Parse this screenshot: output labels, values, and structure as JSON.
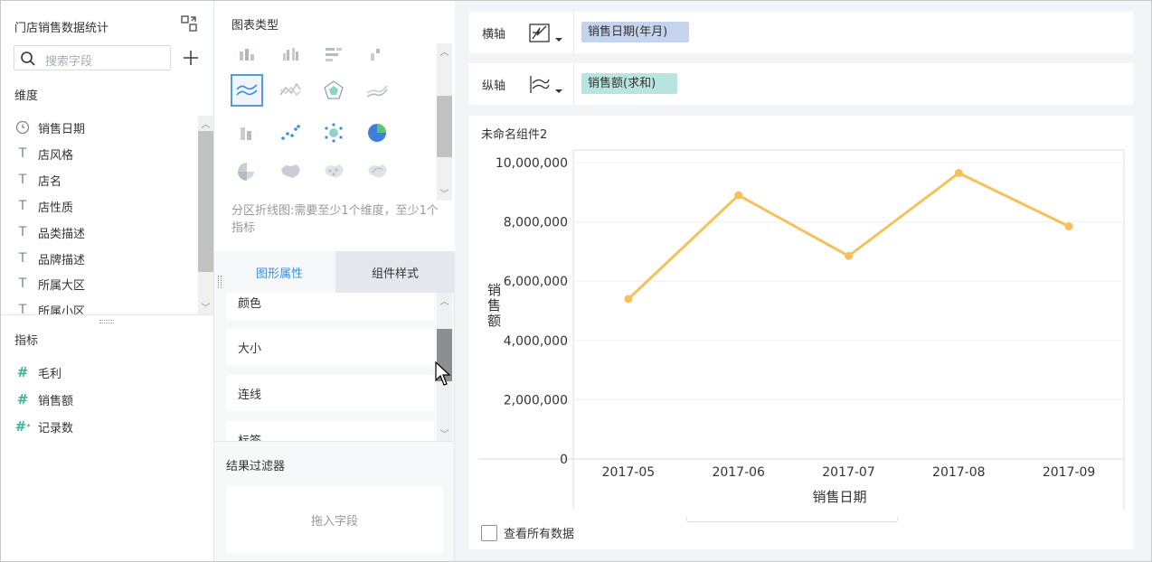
{
  "left_panel": {
    "title": "门店销售数据统计",
    "search_placeholder": "搜索字段",
    "dimension_label": "维度",
    "dimensions": [
      {
        "label": "销售日期",
        "icon": "clock-icon"
      },
      {
        "label": "店风格",
        "icon": "text-field-icon"
      },
      {
        "label": "店名",
        "icon": "text-field-icon"
      },
      {
        "label": "店性质",
        "icon": "text-field-icon"
      },
      {
        "label": "品类描述",
        "icon": "text-field-icon"
      },
      {
        "label": "品牌描述",
        "icon": "text-field-icon"
      },
      {
        "label": "所属大区",
        "icon": "text-field-icon"
      },
      {
        "label": "所属小区",
        "icon": "text-field-icon"
      }
    ],
    "metric_label": "指标",
    "metrics": [
      {
        "label": "毛利",
        "icon": "number-field-icon"
      },
      {
        "label": "销售额",
        "icon": "number-field-icon"
      },
      {
        "label": "记录数",
        "icon": "number-field-star-icon"
      }
    ]
  },
  "middle_panel": {
    "chart_type_label": "图表类型",
    "chart_description": "分区折线图:需要至少1个维度，至少1个指标",
    "tabs": [
      "图形属性",
      "组件样式"
    ],
    "properties": [
      "颜色",
      "大小",
      "连线",
      "标签"
    ],
    "filter_title": "结果过滤器",
    "filter_placeholder": "拖入字段"
  },
  "axes": {
    "x_label": "横轴",
    "x_field": "销售日期(年月)",
    "y_label": "纵轴",
    "y_field": "销售额(求和)"
  },
  "chart_card": {
    "title": "未命名组件2",
    "view_all": "查看所有数据"
  },
  "chart_data": {
    "type": "line",
    "categories": [
      "2017-05",
      "2017-06",
      "2017-07",
      "2017-08",
      "2017-09"
    ],
    "values": [
      5400000,
      8900000,
      6850000,
      9650000,
      7850000
    ],
    "ylim": [
      0,
      10000000
    ],
    "yticks": [
      "0",
      "2,000,000",
      "4,000,000",
      "6,000,000",
      "8,000,000",
      "10,000,000"
    ],
    "xlabel": "销售日期",
    "ylabel": "销售额",
    "color": "#f6c15b",
    "grid": true
  },
  "colors": {
    "accent": "#3e8ed9",
    "line": "#f6c15b",
    "pill_blue": "#c5d4ee",
    "pill_green": "#b9e4df"
  }
}
